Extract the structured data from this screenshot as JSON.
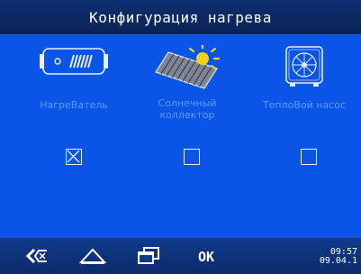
{
  "header": {
    "title": "Конфигурация нагрева"
  },
  "options": [
    {
      "label": "НагреВатель",
      "checked": true
    },
    {
      "label": "Солнечный\nколлектор",
      "checked": false
    },
    {
      "label": "ТеплоВой насос",
      "checked": false
    }
  ],
  "icons": {
    "heater": "heater-icon",
    "solar": "solar-collector-icon",
    "pump": "heat-pump-icon",
    "back": "back-icon",
    "home": "home-icon",
    "windows": "windows-icon"
  },
  "footer": {
    "ok_label": "OK",
    "time": "09:57",
    "date": "09.04.1"
  },
  "colors": {
    "background": "#0a55e6",
    "label": "#5f9bff",
    "titlebar": "#0f2f72",
    "sun": "#f2d21c"
  }
}
